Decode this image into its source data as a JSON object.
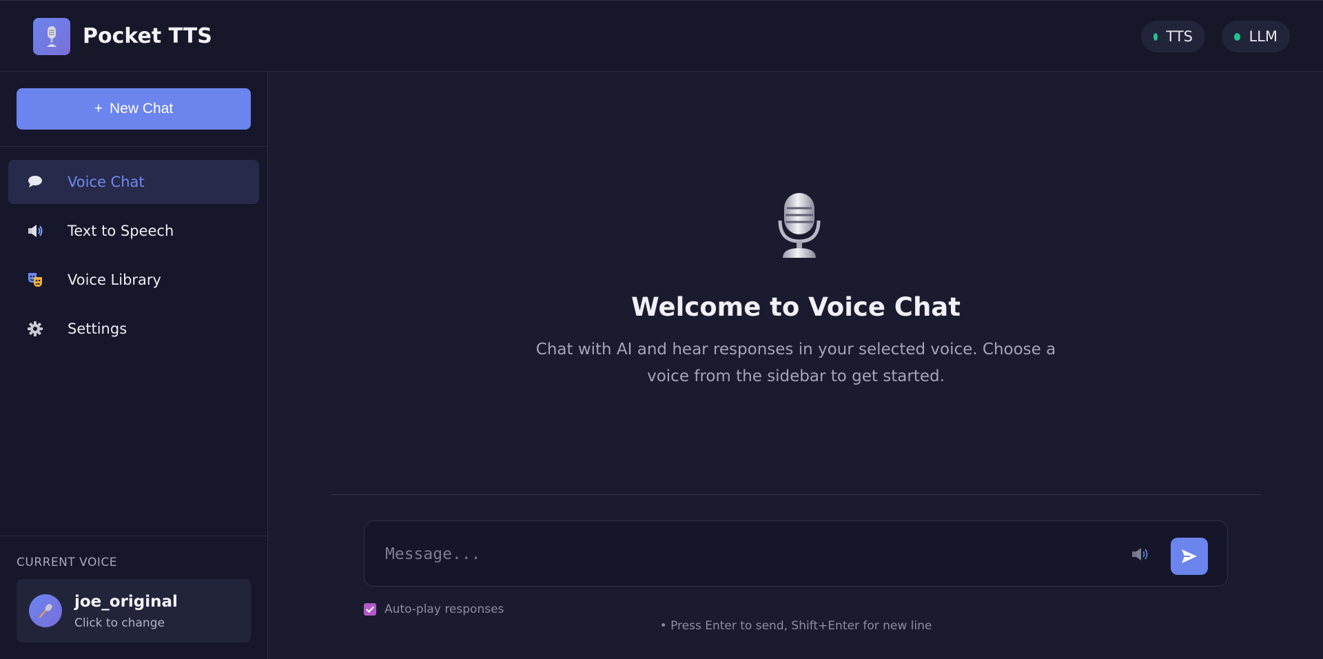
{
  "header": {
    "app_title": "Pocket TTS",
    "logo_icon": "microphone-icon",
    "status": [
      {
        "label": "TTS",
        "state": "online",
        "color": "#22c28a"
      },
      {
        "label": "LLM",
        "state": "online",
        "color": "#22c28a"
      }
    ]
  },
  "sidebar": {
    "new_chat_icon": "+",
    "new_chat_label": "New Chat",
    "items": [
      {
        "label": "Voice Chat",
        "icon": "speech-bubble-icon",
        "active": true
      },
      {
        "label": "Text to Speech",
        "icon": "speaker-icon",
        "active": false
      },
      {
        "label": "Voice Library",
        "icon": "theater-masks-icon",
        "active": false
      },
      {
        "label": "Settings",
        "icon": "gear-icon",
        "active": false
      }
    ],
    "current_voice_label": "CURRENT VOICE",
    "current_voice": {
      "name": "joe_original",
      "subtitle": "Click to change",
      "icon": "microphone-icon"
    }
  },
  "main": {
    "welcome_icon": "studio-microphone-icon",
    "welcome_title": "Welcome to Voice Chat",
    "welcome_text": "Chat with AI and hear responses in your selected voice. Choose a voice from the sidebar to get started.",
    "composer": {
      "placeholder": "Message...",
      "value": "",
      "speaker_icon": "speaker-icon",
      "send_icon": "send-icon"
    },
    "autoplay": {
      "label": "Auto-play responses",
      "checked": true
    },
    "hint": "• Press Enter to send, Shift+Enter for new line"
  },
  "colors": {
    "accent": "#6b84ee",
    "background": "#1a1b2e",
    "sidebar": "#16172a",
    "status_online": "#22c28a",
    "checkbox": "#b15ac8"
  }
}
